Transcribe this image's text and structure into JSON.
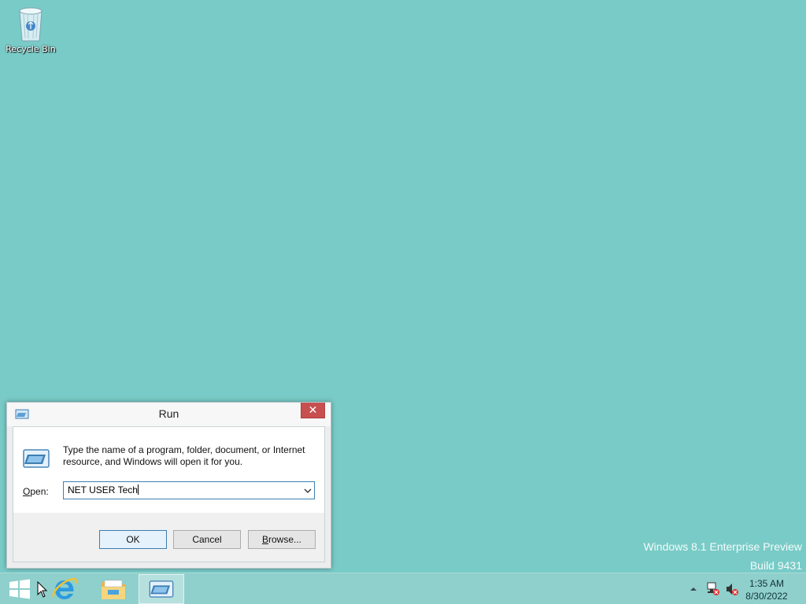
{
  "desktop": {
    "icons": [
      {
        "label": "Recycle Bin",
        "icon": "recycle-bin-icon"
      }
    ],
    "watermark": {
      "line1": "Windows 8.1 Enterprise Preview",
      "line2": "Build 9431"
    }
  },
  "run_dialog": {
    "title": "Run",
    "close_glyph": "✕",
    "description": "Type the name of a program, folder, document, or Internet resource, and Windows will open it for you.",
    "open_label_mnemonic": "O",
    "open_label_rest": "pen:",
    "open_value": "NET USER Tech",
    "buttons": {
      "ok": "OK",
      "cancel": "Cancel",
      "browse_mnemonic": "B",
      "browse_rest": "rowse..."
    }
  },
  "taskbar": {
    "items": [
      {
        "name": "start-button",
        "icon": "windows-logo-icon"
      },
      {
        "name": "internet-explorer",
        "icon": "internet-explorer-icon"
      },
      {
        "name": "file-explorer",
        "icon": "folder-icon"
      },
      {
        "name": "run",
        "icon": "run-icon",
        "active": true
      }
    ],
    "tray": {
      "time": "1:35 AM",
      "date": "8/30/2022"
    }
  },
  "colors": {
    "desktop_bg": "#79cbc7",
    "taskbar_bg": "#8fcfcc",
    "close_button": "#c74f50",
    "focus_border": "#3c7fb1"
  }
}
